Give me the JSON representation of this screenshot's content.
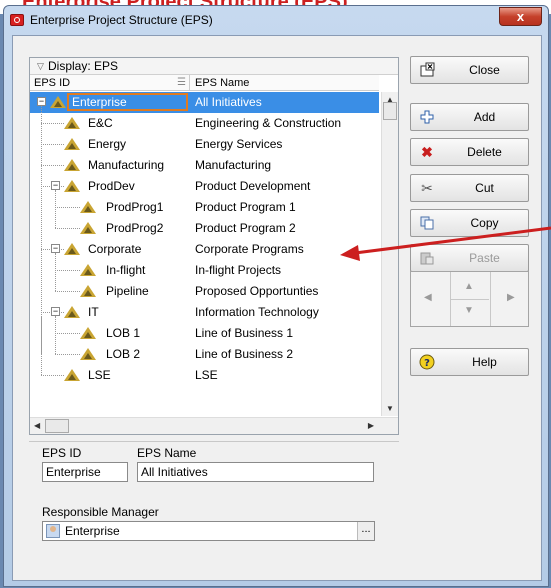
{
  "background": {
    "header_fragment": "Enterprise Project Structure (EPS)"
  },
  "window": {
    "title": "Enterprise Project Structure (EPS)",
    "close_glyph": "x"
  },
  "tree": {
    "display_label": "Display: EPS",
    "columns": [
      "EPS ID",
      "EPS Name"
    ],
    "rows": [
      {
        "id": "Enterprise",
        "name": "All Initiatives",
        "level": 0,
        "expander": "minus",
        "selected": true
      },
      {
        "id": "E&C",
        "name": "Engineering & Construction",
        "level": 1,
        "expander": "none"
      },
      {
        "id": "Energy",
        "name": "Energy Services",
        "level": 1,
        "expander": "none"
      },
      {
        "id": "Manufacturing",
        "name": "Manufacturing",
        "level": 1,
        "expander": "none"
      },
      {
        "id": "ProdDev",
        "name": "Product Development",
        "level": 1,
        "expander": "minus"
      },
      {
        "id": "ProdProg1",
        "name": "Product Program 1",
        "level": 2,
        "expander": "none"
      },
      {
        "id": "ProdProg2",
        "name": "Product Program 2",
        "level": 2,
        "expander": "none"
      },
      {
        "id": "Corporate",
        "name": "Corporate Programs",
        "level": 1,
        "expander": "minus"
      },
      {
        "id": "In-flight",
        "name": "In-flight Projects",
        "level": 2,
        "expander": "none"
      },
      {
        "id": "Pipeline",
        "name": "Proposed Opportunties",
        "level": 2,
        "expander": "none"
      },
      {
        "id": "IT",
        "name": "Information Technology",
        "level": 1,
        "expander": "minus"
      },
      {
        "id": "LOB 1",
        "name": "Line of Business 1",
        "level": 2,
        "expander": "none"
      },
      {
        "id": "LOB 2",
        "name": "Line of Business 2",
        "level": 2,
        "expander": "none"
      },
      {
        "id": "LSE",
        "name": "LSE",
        "level": 1,
        "expander": "none"
      }
    ]
  },
  "buttons": {
    "close": "Close",
    "add": "Add",
    "delete": "Delete",
    "cut": "Cut",
    "copy": "Copy",
    "paste": "Paste",
    "help": "Help"
  },
  "details": {
    "eps_id_label": "EPS ID",
    "eps_name_label": "EPS Name",
    "eps_id_value": "Enterprise",
    "eps_name_value": "All Initiatives",
    "manager_label": "Responsible Manager",
    "manager_value": "Enterprise",
    "ellipsis": "..."
  },
  "colors": {
    "selection": "#3a8ee6",
    "annotation_arrow": "#cc1f1f",
    "selection_outline": "#e07b20"
  }
}
